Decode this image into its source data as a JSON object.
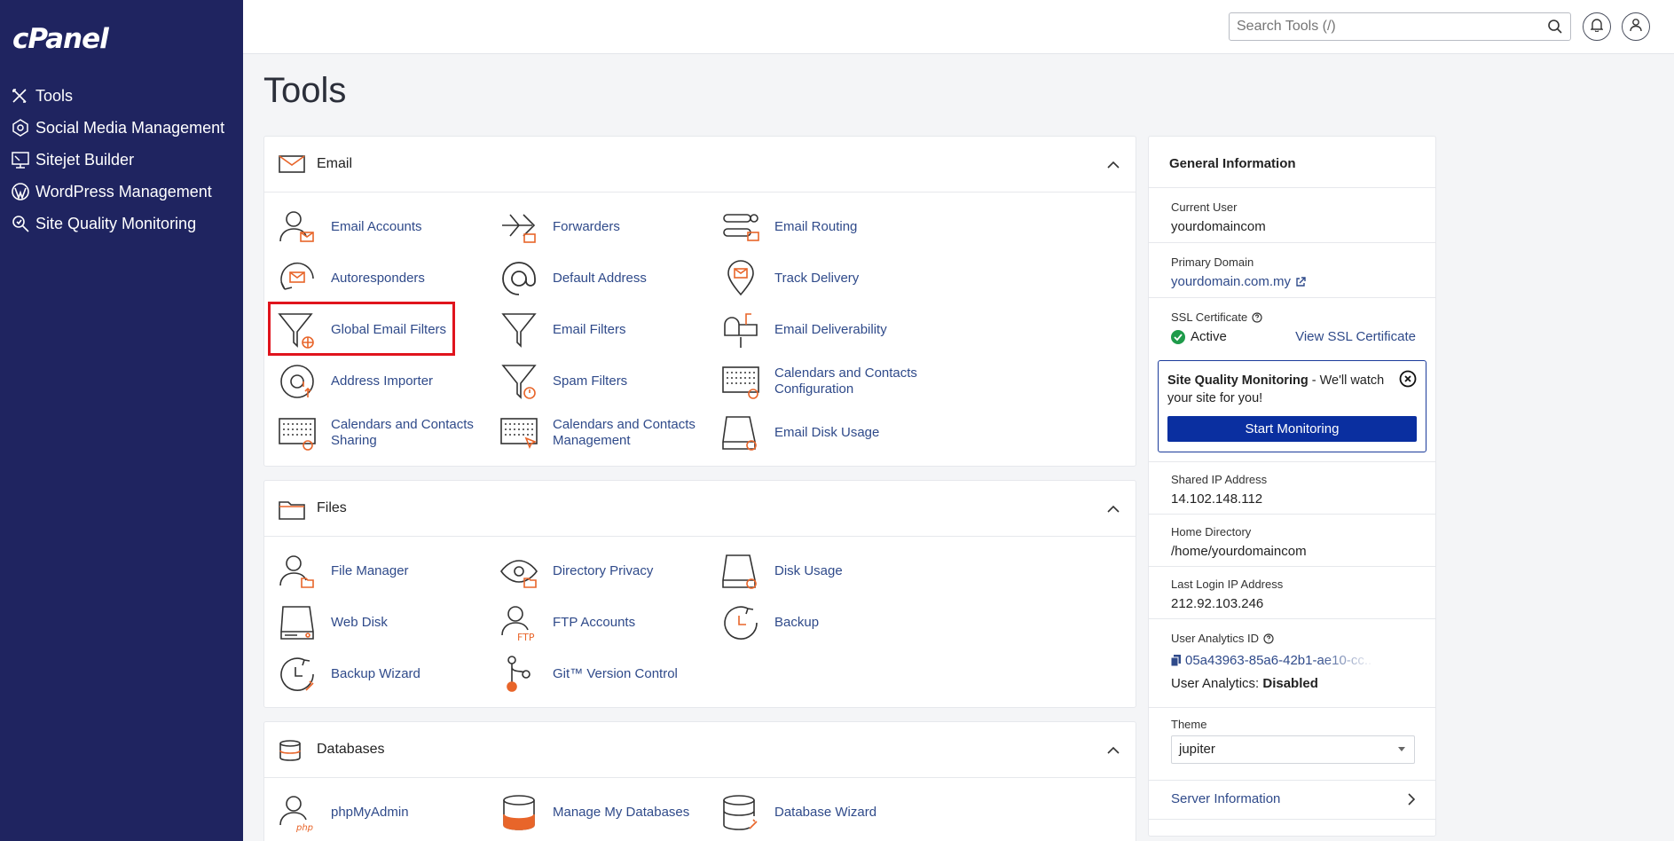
{
  "sidebar": {
    "logo": "cPanel",
    "items": [
      {
        "label": "Tools"
      },
      {
        "label": "Social Media Management"
      },
      {
        "label": "Sitejet Builder"
      },
      {
        "label": "WordPress Management"
      },
      {
        "label": "Site Quality Monitoring"
      }
    ]
  },
  "search": {
    "placeholder": "Search Tools (/)"
  },
  "page": {
    "title": "Tools"
  },
  "email": {
    "title": "Email",
    "tools": [
      {
        "label": "Email Accounts"
      },
      {
        "label": "Forwarders"
      },
      {
        "label": "Email Routing"
      },
      {
        "label": "Autoresponders"
      },
      {
        "label": "Default Address"
      },
      {
        "label": "Track Delivery"
      },
      {
        "label": "Global Email Filters"
      },
      {
        "label": "Email Filters"
      },
      {
        "label": "Email Deliverability"
      },
      {
        "label": "Address Importer"
      },
      {
        "label": "Spam Filters"
      },
      {
        "label": "Calendars and Contacts Configuration"
      },
      {
        "label": "Calendars and Contacts Sharing"
      },
      {
        "label": "Calendars and Contacts Management"
      },
      {
        "label": "Email Disk Usage"
      }
    ]
  },
  "files": {
    "title": "Files",
    "tools": [
      {
        "label": "File Manager"
      },
      {
        "label": "Directory Privacy"
      },
      {
        "label": "Disk Usage"
      },
      {
        "label": "Web Disk"
      },
      {
        "label": "FTP Accounts"
      },
      {
        "label": "Backup"
      },
      {
        "label": "Backup Wizard"
      },
      {
        "label": "Git™ Version Control"
      }
    ]
  },
  "databases": {
    "title": "Databases",
    "tools": [
      {
        "label": "phpMyAdmin"
      },
      {
        "label": "Manage My Databases"
      },
      {
        "label": "Database Wizard"
      }
    ]
  },
  "info": {
    "title": "General Information",
    "current_user_label": "Current User",
    "current_user": "yourdomaincom",
    "primary_domain_label": "Primary Domain",
    "primary_domain": "yourdomain.com.my",
    "ssl_label": "SSL Certificate",
    "ssl_status": "Active",
    "ssl_link": "View SSL Certificate",
    "sqm_bold": "Site Quality Monitoring",
    "sqm_text": " - We'll watch your site for you!",
    "sqm_button": "Start Monitoring",
    "shared_ip_label": "Shared IP Address",
    "shared_ip": "14.102.148.112",
    "home_dir_label": "Home Directory",
    "home_dir": "/home/yourdomaincom",
    "last_login_label": "Last Login IP Address",
    "last_login": "212.92.103.246",
    "analytics_id_label": "User Analytics ID",
    "analytics_id": "05a43963-85a6-42b1-ae10-cc...",
    "analytics_status_label": "User Analytics: ",
    "analytics_status": "Disabled",
    "theme_label": "Theme",
    "theme": "jupiter",
    "server_info": "Server Information"
  },
  "colors": {
    "sidebar": "#1f2460",
    "link": "#2f4a8a",
    "accent": "#e8652a",
    "highlight": "#e0141d",
    "button": "#0a2fa0"
  }
}
